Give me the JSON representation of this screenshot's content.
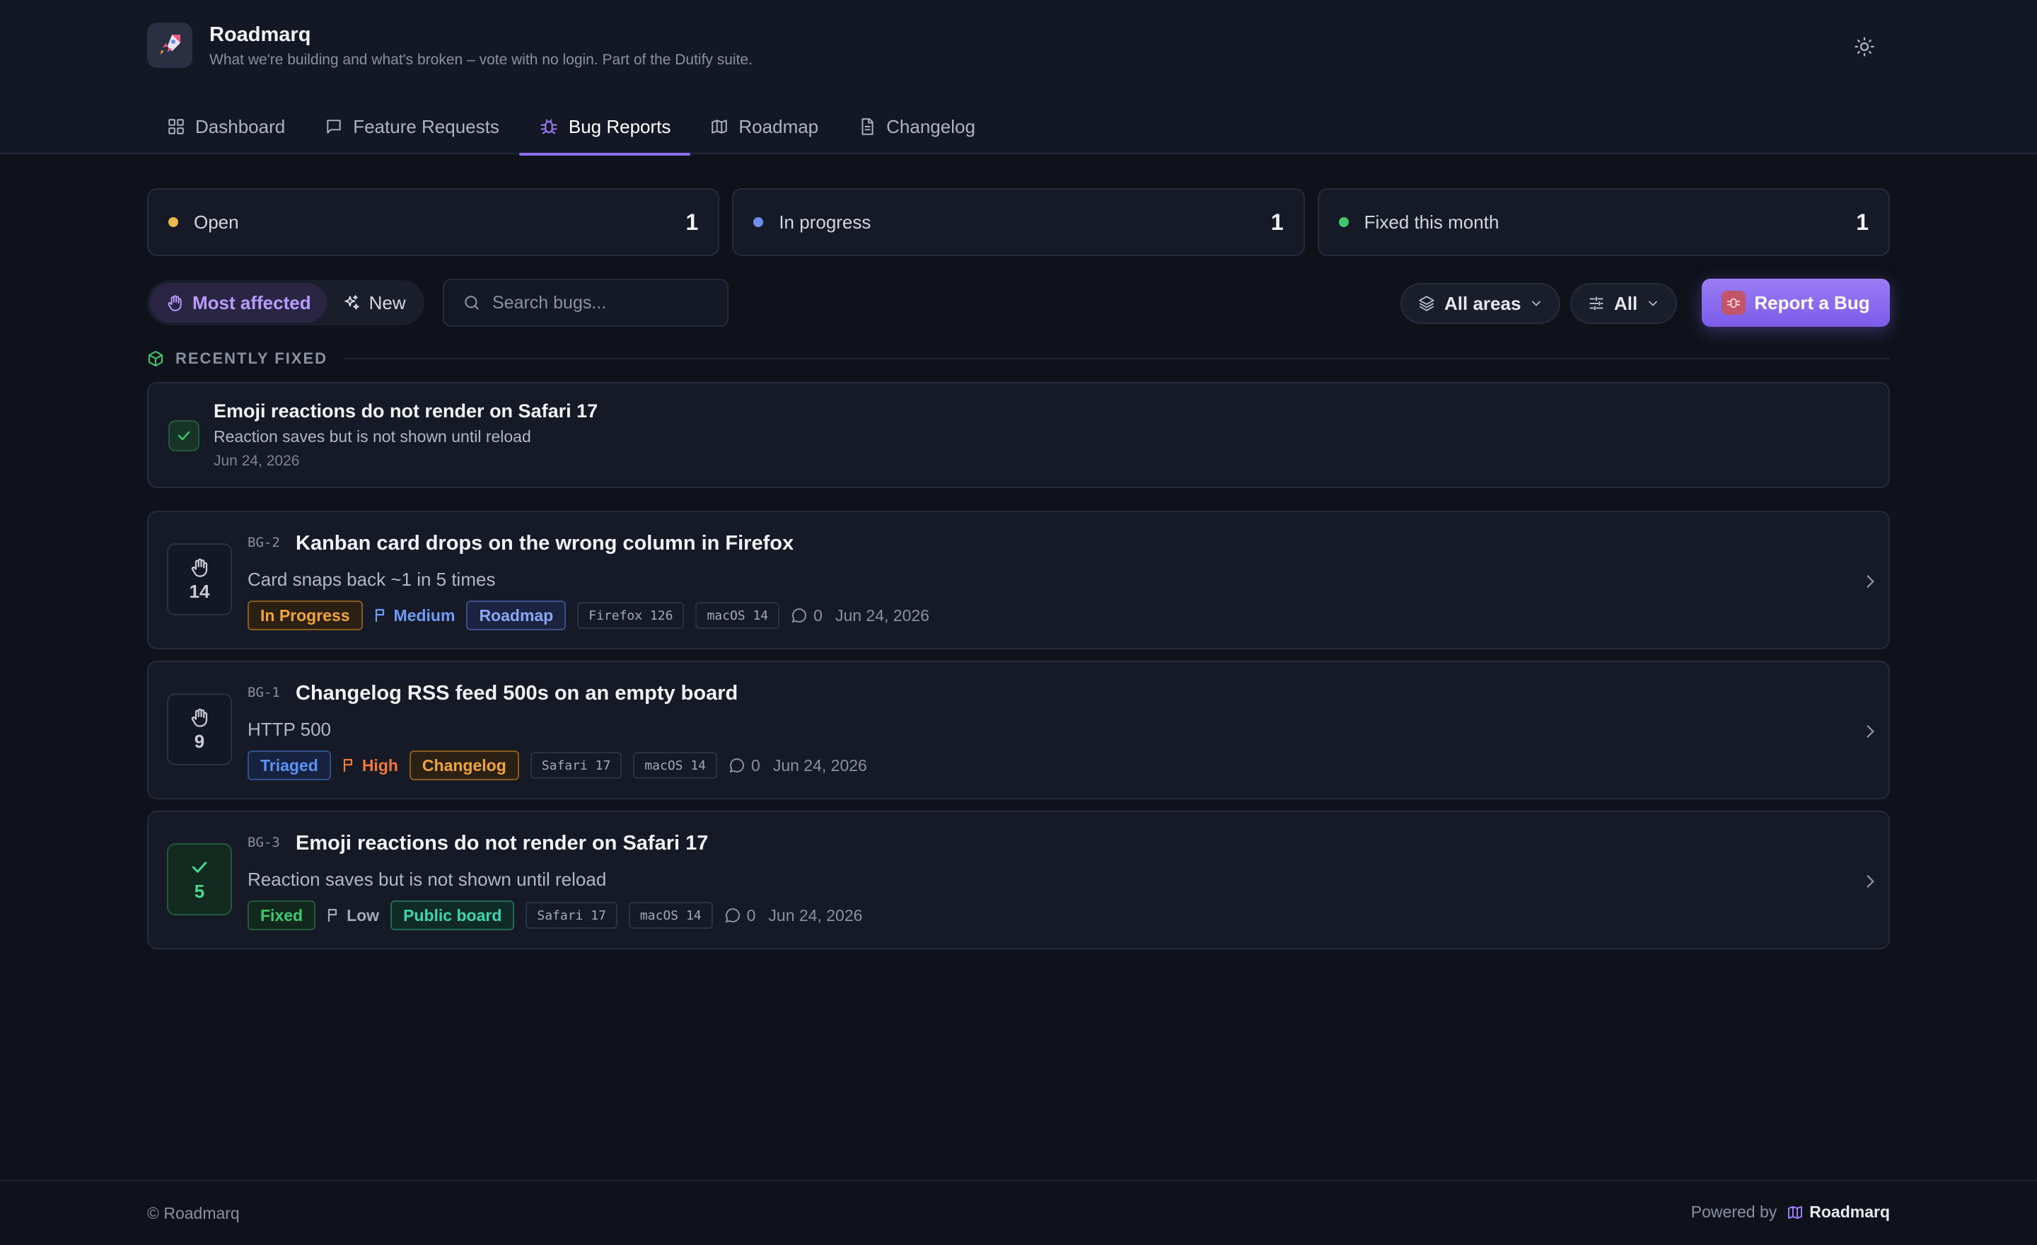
{
  "app": {
    "name": "Roadmarq",
    "tagline": "What we're building and what's broken – vote with no login. Part of the Dutify suite."
  },
  "nav": {
    "tabs": [
      {
        "label": "Dashboard",
        "icon": "grid-icon"
      },
      {
        "label": "Feature Requests",
        "icon": "message-icon"
      },
      {
        "label": "Bug Reports",
        "icon": "bug-icon",
        "active": true
      },
      {
        "label": "Roadmap",
        "icon": "map-icon"
      },
      {
        "label": "Changelog",
        "icon": "document-icon"
      }
    ]
  },
  "stats": [
    {
      "label": "Open",
      "value": "1",
      "color": "#e9b949"
    },
    {
      "label": "In progress",
      "value": "1",
      "color": "#6d8cf0"
    },
    {
      "label": "Fixed this month",
      "value": "1",
      "color": "#3fca6f"
    }
  ],
  "toolbar": {
    "sort_most_affected": "Most affected",
    "sort_new": "New",
    "search_placeholder": "Search bugs...",
    "areas_filter": "All areas",
    "status_filter": "All",
    "report_button": "Report a Bug"
  },
  "recently_fixed": {
    "heading": "RECENTLY FIXED",
    "items": [
      {
        "title": "Emoji reactions do not render on Safari 17",
        "description": "Reaction saves but is not shown until reload",
        "date": "Jun 24, 2026"
      }
    ]
  },
  "bugs": [
    {
      "id": "BG-2",
      "title": "Kanban card drops on the wrong column in Firefox",
      "description": "Card snaps back ~1 in 5 times",
      "votes": "14",
      "status": "In Progress",
      "status_color": "#f0a63a",
      "priority": "Medium",
      "priority_color": "#6d9cf5",
      "area": "Roadmap",
      "area_color": "#8aa6f5",
      "env": [
        "Firefox 126",
        "macOS 14"
      ],
      "comments": "0",
      "date": "Jun 24, 2026"
    },
    {
      "id": "BG-1",
      "title": "Changelog RSS feed 500s on an empty board",
      "description": "HTTP 500",
      "votes": "9",
      "status": "Triaged",
      "status_color": "#5b93f5",
      "priority": "High",
      "priority_color": "#f07a3a",
      "area": "Changelog",
      "area_color": "#f0a63a",
      "env": [
        "Safari 17",
        "macOS 14"
      ],
      "comments": "0",
      "date": "Jun 24, 2026"
    },
    {
      "id": "BG-3",
      "title": "Emoji reactions do not render on Safari 17",
      "description": "Reaction saves but is not shown until reload",
      "votes": "5",
      "status": "Fixed",
      "status_color": "#3fca6f",
      "priority": "Low",
      "priority_color": "#a4a9b8",
      "area": "Public board",
      "area_color": "#3fd4b0",
      "env": [
        "Safari 17",
        "macOS 14"
      ],
      "comments": "0",
      "date": "Jun 24, 2026"
    }
  ],
  "footer": {
    "copyright": "© Roadmarq",
    "powered_by": "Powered by",
    "powered_name": "Roadmarq"
  }
}
